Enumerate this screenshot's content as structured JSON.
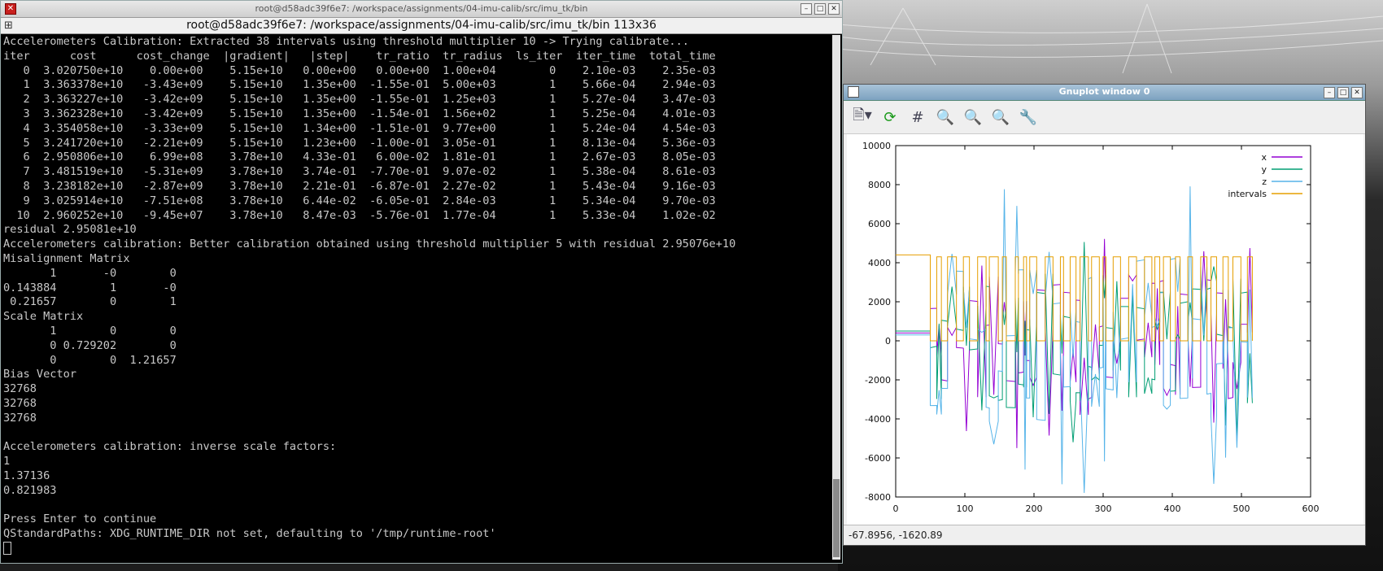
{
  "terminal": {
    "window_title": "root@d58adc39f6e7: /workspace/assignments/04-imu-calib/src/imu_tk/bin",
    "tab_title": "root@d58adc39f6e7: /workspace/assignments/04-imu-calib/src/imu_tk/bin 113x36",
    "lines": [
      "Accelerometers Calibration: Extracted 38 intervals using threshold multiplier 10 -> Trying calibrate...",
      "iter      cost      cost_change  |gradient|   |step|    tr_ratio  tr_radius  ls_iter  iter_time  total_time",
      "   0  3.020750e+10    0.00e+00    5.15e+10   0.00e+00   0.00e+00  1.00e+04        0    2.10e-03    2.35e-03",
      "   1  3.363378e+10   -3.43e+09    5.15e+10   1.35e+00  -1.55e-01  5.00e+03        1    5.66e-04    2.94e-03",
      "   2  3.363227e+10   -3.42e+09    5.15e+10   1.35e+00  -1.55e-01  1.25e+03        1    5.27e-04    3.47e-03",
      "   3  3.362328e+10   -3.42e+09    5.15e+10   1.35e+00  -1.54e-01  1.56e+02        1    5.25e-04    4.01e-03",
      "   4  3.354058e+10   -3.33e+09    5.15e+10   1.34e+00  -1.51e-01  9.77e+00        1    5.24e-04    4.54e-03",
      "   5  3.241720e+10   -2.21e+09    5.15e+10   1.23e+00  -1.00e-01  3.05e-01        1    8.13e-04    5.36e-03",
      "   6  2.950806e+10    6.99e+08    3.78e+10   4.33e-01   6.00e-02  1.81e-01        1    2.67e-03    8.05e-03",
      "   7  3.481519e+10   -5.31e+09    3.78e+10   3.74e-01  -7.70e-01  9.07e-02        1    5.38e-04    8.61e-03",
      "   8  3.238182e+10   -2.87e+09    3.78e+10   2.21e-01  -6.87e-01  2.27e-02        1    5.43e-04    9.16e-03",
      "   9  3.025914e+10   -7.51e+08    3.78e+10   6.44e-02  -6.05e-01  2.84e-03        1    5.34e-04    9.70e-03",
      "  10  2.960252e+10   -9.45e+07    3.78e+10   8.47e-03  -5.76e-01  1.77e-04        1    5.33e-04    1.02e-02",
      "residual 2.95081e+10",
      "Accelerometers calibration: Better calibration obtained using threshold multiplier 5 with residual 2.95076e+10",
      "Misalignment Matrix",
      "       1       -0        0",
      "0.143884        1       -0",
      " 0.21657        0        1",
      "Scale Matrix",
      "       1        0        0",
      "       0 0.729202        0",
      "       0        0  1.21657",
      "Bias Vector",
      "32768",
      "32768",
      "32768",
      "",
      "Accelerometers calibration: inverse scale factors:",
      "1",
      "1.37136",
      "0.821983",
      "",
      "Press Enter to continue",
      "QStandardPaths: XDG_RUNTIME_DIR not set, defaulting to '/tmp/runtime-root'"
    ]
  },
  "gnuplot": {
    "window_title": "Gnuplot window 0",
    "status": "-67.8956, -1620.89",
    "toolbar": [
      "export-icon",
      "replot-icon",
      "grid-icon",
      "zoom-out-icon",
      "zoom-in-icon",
      "zoom-previous-icon",
      "settings-icon"
    ]
  },
  "chart_data": {
    "type": "line",
    "title": "",
    "xlabel": "",
    "ylabel": "",
    "xlim": [
      0,
      600
    ],
    "ylim": [
      -8000,
      10000
    ],
    "x_ticks": [
      0,
      100,
      200,
      300,
      400,
      500,
      600
    ],
    "y_ticks": [
      -8000,
      -6000,
      -4000,
      -2000,
      0,
      2000,
      4000,
      6000,
      8000,
      10000
    ],
    "legend_position": "top-right",
    "series": [
      {
        "name": "x",
        "color": "#9400d3"
      },
      {
        "name": "y",
        "color": "#009e73"
      },
      {
        "name": "z",
        "color": "#56b4e9"
      },
      {
        "name": "intervals",
        "color": "#e69f00"
      }
    ],
    "intervals_levels": {
      "high": 4300,
      "low": 0,
      "start_level": 4400
    },
    "x_range_active": [
      0,
      510
    ],
    "note_series": "dense step-like accelerometer signal; static segments between ~50 and ~510 on x"
  }
}
